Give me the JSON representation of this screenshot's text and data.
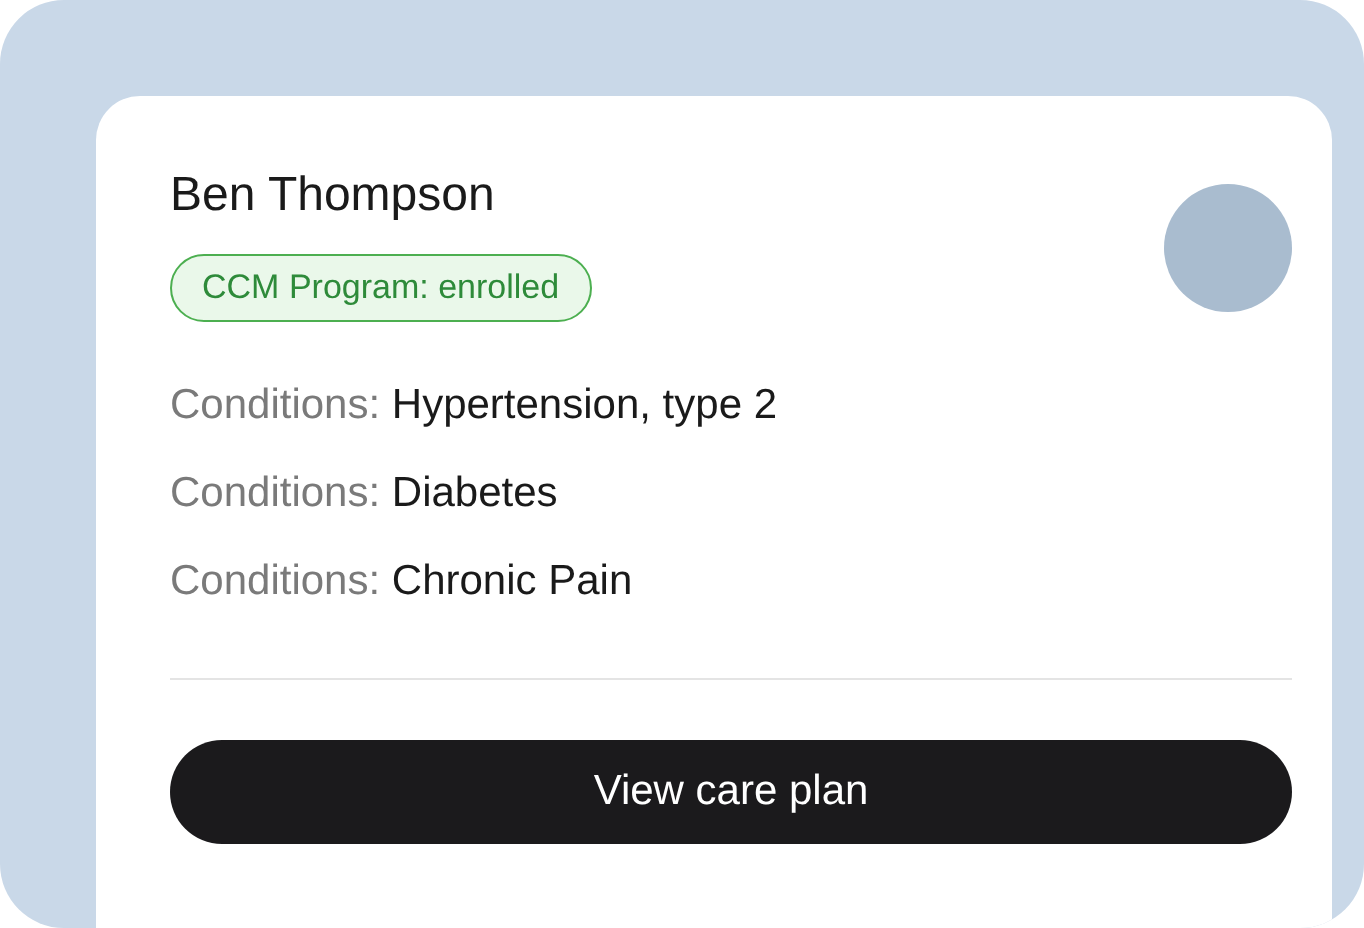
{
  "patient": {
    "name": "Ben Thompson",
    "badge": "CCM Program: enrolled"
  },
  "conditions": [
    {
      "label": "Conditions:",
      "value": "Hypertension, type 2"
    },
    {
      "label": "Conditions:",
      "value": "Diabetes"
    },
    {
      "label": "Conditions:",
      "value": "Chronic Pain"
    }
  ],
  "button": {
    "label": "View care plan"
  }
}
